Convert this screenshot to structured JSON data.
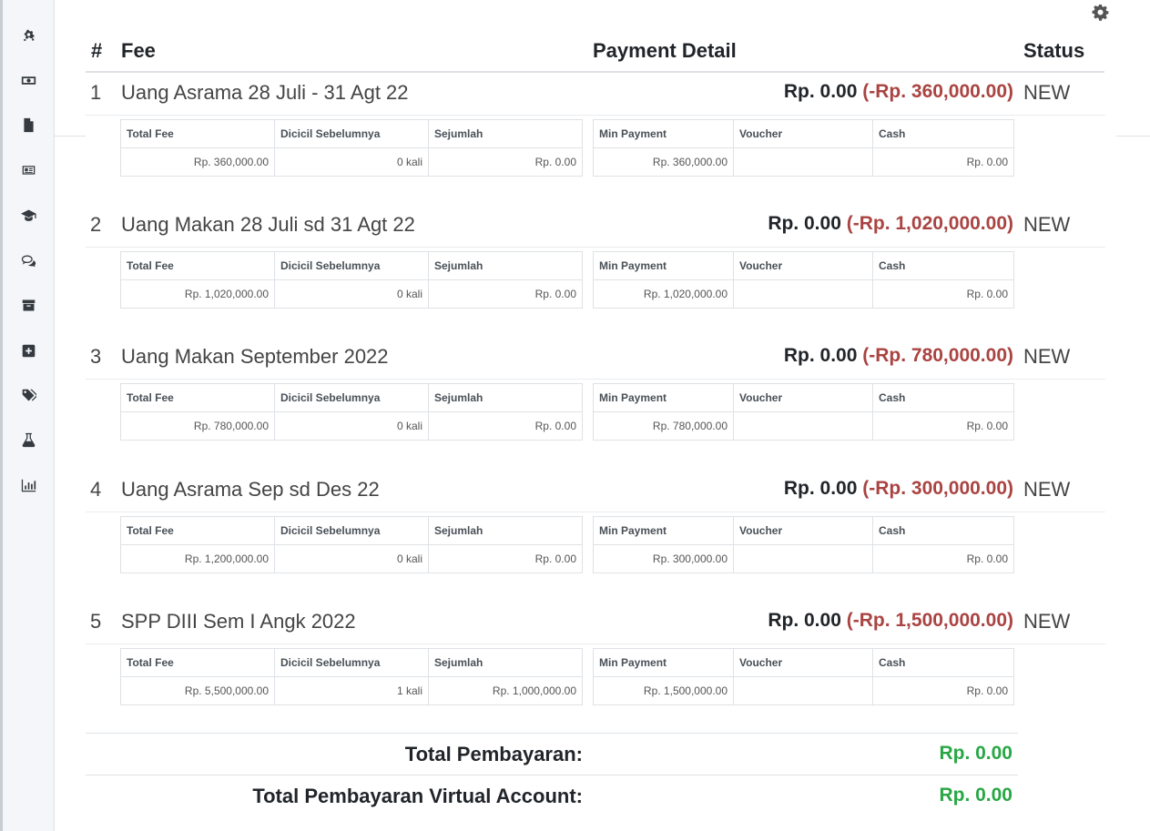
{
  "sidebar": {
    "items": [
      {
        "icon": "cogs-icon"
      },
      {
        "icon": "money-bill-icon"
      },
      {
        "icon": "file-icon"
      },
      {
        "icon": "newspaper-icon"
      },
      {
        "icon": "graduation-cap-icon"
      },
      {
        "icon": "comments-icon"
      },
      {
        "icon": "archive-icon"
      },
      {
        "icon": "plus-square-icon"
      },
      {
        "icon": "tags-icon"
      },
      {
        "icon": "flask-icon"
      },
      {
        "icon": "chart-bar-icon"
      }
    ]
  },
  "header": {
    "num": "#",
    "fee": "Fee",
    "payment_detail": "Payment Detail",
    "status": "Status"
  },
  "detail_headers": {
    "total_fee": "Total Fee",
    "dicicil": "Dicicil Sebelumnya",
    "sejumlah": "Sejumlah",
    "min_payment": "Min Payment",
    "voucher": "Voucher",
    "cash": "Cash"
  },
  "fees": [
    {
      "num": "1",
      "name": "Uang Asrama 28 Juli - 31 Agt 22",
      "paid": "Rp. 0.00",
      "remaining": "(-Rp. 360,000.00)",
      "status": "NEW",
      "total_fee": "Rp. 360,000.00",
      "dicicil": "0 kali",
      "sejumlah": "Rp. 0.00",
      "min_payment": "Rp. 360,000.00",
      "voucher": "",
      "cash": "Rp. 0.00"
    },
    {
      "num": "2",
      "name": "Uang Makan 28 Juli sd 31 Agt 22",
      "paid": "Rp. 0.00",
      "remaining": "(-Rp. 1,020,000.00)",
      "status": "NEW",
      "total_fee": "Rp. 1,020,000.00",
      "dicicil": "0 kali",
      "sejumlah": "Rp. 0.00",
      "min_payment": "Rp. 1,020,000.00",
      "voucher": "",
      "cash": "Rp. 0.00"
    },
    {
      "num": "3",
      "name": "Uang Makan September 2022",
      "paid": "Rp. 0.00",
      "remaining": "(-Rp. 780,000.00)",
      "status": "NEW",
      "total_fee": "Rp. 780,000.00",
      "dicicil": "0 kali",
      "sejumlah": "Rp. 0.00",
      "min_payment": "Rp. 780,000.00",
      "voucher": "",
      "cash": "Rp. 0.00"
    },
    {
      "num": "4",
      "name": "Uang Asrama Sep sd Des 22",
      "paid": "Rp. 0.00",
      "remaining": "(-Rp. 300,000.00)",
      "status": "NEW",
      "total_fee": "Rp. 1,200,000.00",
      "dicicil": "0 kali",
      "sejumlah": "Rp. 0.00",
      "min_payment": "Rp. 300,000.00",
      "voucher": "",
      "cash": "Rp. 0.00"
    },
    {
      "num": "5",
      "name": "SPP DIII Sem I Angk 2022",
      "paid": "Rp. 0.00",
      "remaining": "(-Rp. 1,500,000.00)",
      "status": "NEW",
      "total_fee": "Rp. 5,500,000.00",
      "dicicil": "1 kali",
      "sejumlah": "Rp. 1,000,000.00",
      "min_payment": "Rp. 1,500,000.00",
      "voucher": "",
      "cash": "Rp. 0.00"
    }
  ],
  "totals": {
    "pembayaran_label": "Total Pembayaran:",
    "pembayaran_value": "Rp. 0.00",
    "va_label": "Total Pembayaran Virtual Account:",
    "va_value": "Rp. 0.00"
  },
  "colors": {
    "negative": "#a94442",
    "total_green": "#28a745"
  }
}
